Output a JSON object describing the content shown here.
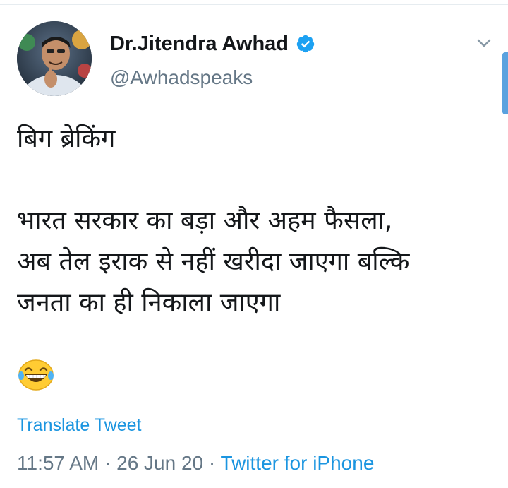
{
  "tweet": {
    "author": {
      "display_name": "Dr.Jitendra Awhad",
      "handle": "@Awhadspeaks",
      "verified": true,
      "avatar": "avatar-photo"
    },
    "text_lines": [
      "बिग ब्रेकिंग",
      "भारत सरकार का बड़ा और अहम फैसला,",
      "अब तेल इराक से नहीं खरीदा जाएगा बल्कि",
      "जनता का ही निकाला जाएगा"
    ],
    "emoji": "😂",
    "translate_label": "Translate Tweet",
    "time": "11:57 AM",
    "date": "26 Jun 20",
    "separator": "·",
    "source": "Twitter for iPhone"
  },
  "icons": {
    "verified": "verified-badge-icon",
    "menu": "chevron-down-icon",
    "emoji": "laughing-emoji-icon"
  },
  "colors": {
    "link": "#1b95e0",
    "secondary_text": "#657786",
    "primary_text": "#14171a",
    "verified": "#1da1f2",
    "divider": "#e6ecf0"
  }
}
